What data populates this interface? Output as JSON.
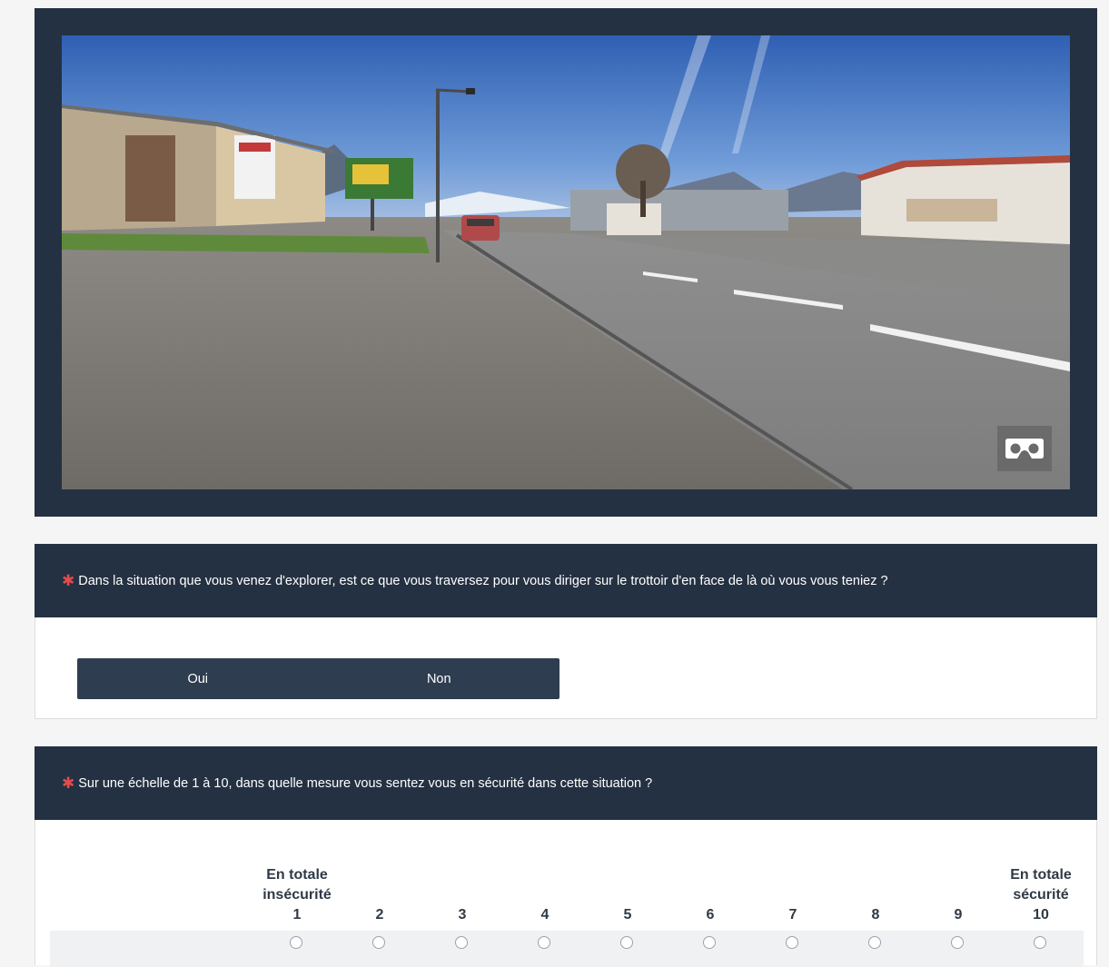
{
  "panorama": {
    "vr_button_icon": "vr-headset-icon"
  },
  "question1": {
    "required_mark": "✱",
    "text": "Dans la situation que vous venez d'explorer, est ce que vous traversez pour vous diriger sur le trottoir d'en face de là où vous vous teniez ?",
    "options": [
      "Oui",
      "Non"
    ]
  },
  "question2": {
    "required_mark": "✱",
    "text": "Sur une échelle de 1 à 10, dans quelle mesure vous sentez vous en sécurité dans cette situation ?",
    "min_label_line1": "En totale",
    "min_label_line2": "insécurité",
    "max_label_line1": "En totale",
    "max_label_line2": "sécurité",
    "scale": [
      "1",
      "2",
      "3",
      "4",
      "5",
      "6",
      "7",
      "8",
      "9",
      "10"
    ]
  },
  "colors": {
    "header_bg": "#243142",
    "button_bg": "#2e3d4f",
    "required": "#e54b4b"
  }
}
